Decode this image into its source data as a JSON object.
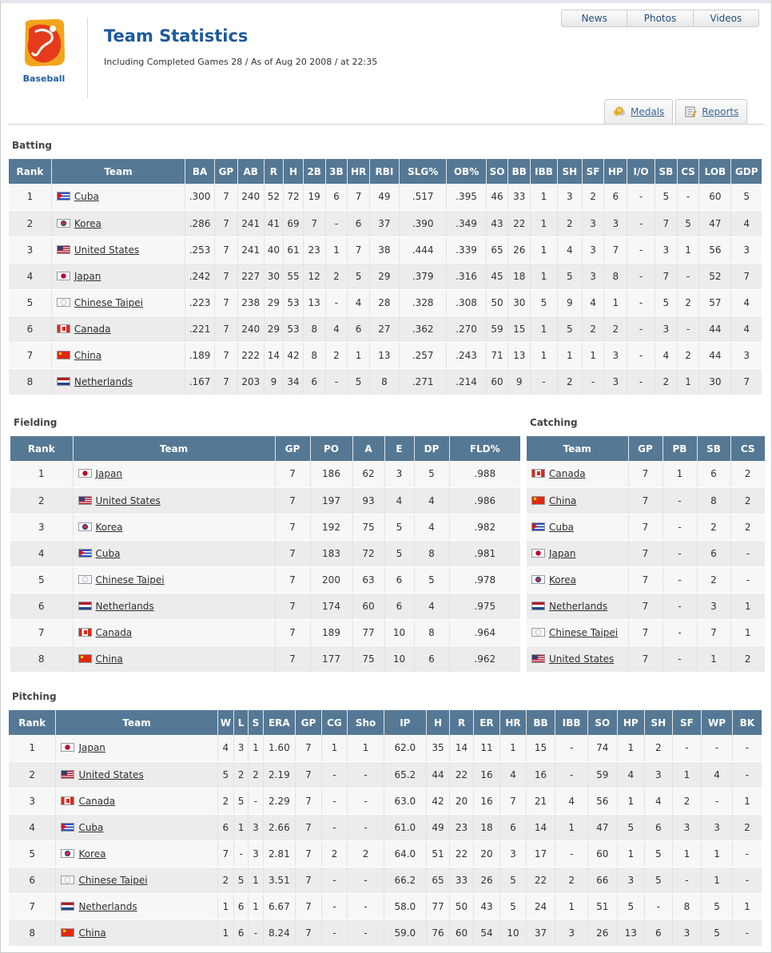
{
  "header": {
    "sport_label": "Baseball",
    "title": "Team Statistics",
    "subtitle": "Including Completed Games 28 / As of Aug 20 2008 / at 22:35"
  },
  "nav": {
    "news": "News",
    "photos": "Photos",
    "videos": "Videos"
  },
  "tabs": {
    "medals": "Medals",
    "reports": "Reports"
  },
  "batting": {
    "section_title": "Batting",
    "columns": [
      "Rank",
      "Team",
      "BA",
      "GP",
      "AB",
      "R",
      "H",
      "2B",
      "3B",
      "HR",
      "RBI",
      "SLG%",
      "OB%",
      "SO",
      "BB",
      "IBB",
      "SH",
      "SF",
      "HP",
      "I/O",
      "SB",
      "CS",
      "LOB",
      "GDP"
    ],
    "rows": [
      {
        "flag": "cuba",
        "cells": [
          "1",
          "Cuba",
          ".300",
          "7",
          "240",
          "52",
          "72",
          "19",
          "6",
          "7",
          "49",
          ".517",
          ".395",
          "46",
          "33",
          "1",
          "3",
          "2",
          "6",
          "-",
          "5",
          "-",
          "60",
          "5"
        ]
      },
      {
        "flag": "korea",
        "cells": [
          "2",
          "Korea",
          ".286",
          "7",
          "241",
          "41",
          "69",
          "7",
          "-",
          "6",
          "37",
          ".390",
          ".349",
          "43",
          "22",
          "1",
          "2",
          "3",
          "3",
          "-",
          "7",
          "5",
          "47",
          "4"
        ]
      },
      {
        "flag": "usa",
        "cells": [
          "3",
          "United States",
          ".253",
          "7",
          "241",
          "40",
          "61",
          "23",
          "1",
          "7",
          "38",
          ".444",
          ".339",
          "65",
          "26",
          "1",
          "4",
          "3",
          "7",
          "-",
          "3",
          "1",
          "56",
          "3"
        ]
      },
      {
        "flag": "japan",
        "cells": [
          "4",
          "Japan",
          ".242",
          "7",
          "227",
          "30",
          "55",
          "12",
          "2",
          "5",
          "29",
          ".379",
          ".316",
          "45",
          "18",
          "1",
          "5",
          "3",
          "8",
          "-",
          "7",
          "-",
          "52",
          "7"
        ]
      },
      {
        "flag": "tpe",
        "cells": [
          "5",
          "Chinese Taipei",
          ".223",
          "7",
          "238",
          "29",
          "53",
          "13",
          "-",
          "4",
          "28",
          ".328",
          ".308",
          "50",
          "30",
          "5",
          "9",
          "4",
          "1",
          "-",
          "5",
          "2",
          "57",
          "4"
        ]
      },
      {
        "flag": "canada",
        "cells": [
          "6",
          "Canada",
          ".221",
          "7",
          "240",
          "29",
          "53",
          "8",
          "4",
          "6",
          "27",
          ".362",
          ".270",
          "59",
          "15",
          "1",
          "5",
          "2",
          "2",
          "-",
          "3",
          "-",
          "44",
          "4"
        ]
      },
      {
        "flag": "china",
        "cells": [
          "7",
          "China",
          ".189",
          "7",
          "222",
          "14",
          "42",
          "8",
          "2",
          "1",
          "13",
          ".257",
          ".243",
          "71",
          "13",
          "1",
          "1",
          "1",
          "3",
          "-",
          "4",
          "2",
          "44",
          "3"
        ]
      },
      {
        "flag": "neth",
        "cells": [
          "8",
          "Netherlands",
          ".167",
          "7",
          "203",
          "9",
          "34",
          "6",
          "-",
          "5",
          "8",
          ".271",
          ".214",
          "60",
          "9",
          "-",
          "2",
          "-",
          "3",
          "-",
          "2",
          "1",
          "30",
          "7"
        ]
      }
    ]
  },
  "fielding": {
    "section_title": "Fielding",
    "columns": [
      "Rank",
      "Team",
      "GP",
      "PO",
      "A",
      "E",
      "DP",
      "FLD%"
    ],
    "rows": [
      {
        "flag": "japan",
        "cells": [
          "1",
          "Japan",
          "7",
          "186",
          "62",
          "3",
          "5",
          ".988"
        ]
      },
      {
        "flag": "usa",
        "cells": [
          "2",
          "United States",
          "7",
          "197",
          "93",
          "4",
          "4",
          ".986"
        ]
      },
      {
        "flag": "korea",
        "cells": [
          "3",
          "Korea",
          "7",
          "192",
          "75",
          "5",
          "4",
          ".982"
        ]
      },
      {
        "flag": "cuba",
        "cells": [
          "4",
          "Cuba",
          "7",
          "183",
          "72",
          "5",
          "8",
          ".981"
        ]
      },
      {
        "flag": "tpe",
        "cells": [
          "5",
          "Chinese Taipei",
          "7",
          "200",
          "63",
          "6",
          "5",
          ".978"
        ]
      },
      {
        "flag": "neth",
        "cells": [
          "6",
          "Netherlands",
          "7",
          "174",
          "60",
          "6",
          "4",
          ".975"
        ]
      },
      {
        "flag": "canada",
        "cells": [
          "7",
          "Canada",
          "7",
          "189",
          "77",
          "10",
          "8",
          ".964"
        ]
      },
      {
        "flag": "china",
        "cells": [
          "8",
          "China",
          "7",
          "177",
          "75",
          "10",
          "6",
          ".962"
        ]
      }
    ]
  },
  "catching": {
    "section_title": "Catching",
    "columns": [
      "Team",
      "GP",
      "PB",
      "SB",
      "CS"
    ],
    "rows": [
      {
        "flag": "canada",
        "cells": [
          "Canada",
          "7",
          "1",
          "6",
          "2"
        ]
      },
      {
        "flag": "china",
        "cells": [
          "China",
          "7",
          "-",
          "8",
          "2"
        ]
      },
      {
        "flag": "cuba",
        "cells": [
          "Cuba",
          "7",
          "-",
          "2",
          "2"
        ]
      },
      {
        "flag": "japan",
        "cells": [
          "Japan",
          "7",
          "-",
          "6",
          "-"
        ]
      },
      {
        "flag": "korea",
        "cells": [
          "Korea",
          "7",
          "-",
          "2",
          "-"
        ]
      },
      {
        "flag": "neth",
        "cells": [
          "Netherlands",
          "7",
          "-",
          "3",
          "1"
        ]
      },
      {
        "flag": "tpe",
        "cells": [
          "Chinese Taipei",
          "7",
          "-",
          "7",
          "1"
        ]
      },
      {
        "flag": "usa",
        "cells": [
          "United States",
          "7",
          "-",
          "1",
          "2"
        ]
      }
    ]
  },
  "pitching": {
    "section_title": "Pitching",
    "columns": [
      "Rank",
      "Team",
      "W",
      "L",
      "S",
      "ERA",
      "GP",
      "CG",
      "Sho",
      "IP",
      "H",
      "R",
      "ER",
      "HR",
      "BB",
      "IBB",
      "SO",
      "HP",
      "SH",
      "SF",
      "WP",
      "BK"
    ],
    "rows": [
      {
        "flag": "japan",
        "cells": [
          "1",
          "Japan",
          "4",
          "3",
          "1",
          "1.60",
          "7",
          "1",
          "1",
          "62.0",
          "35",
          "14",
          "11",
          "1",
          "15",
          "-",
          "74",
          "1",
          "2",
          "-",
          "-",
          "-"
        ]
      },
      {
        "flag": "usa",
        "cells": [
          "2",
          "United States",
          "5",
          "2",
          "2",
          "2.19",
          "7",
          "-",
          "-",
          "65.2",
          "44",
          "22",
          "16",
          "4",
          "16",
          "-",
          "59",
          "4",
          "3",
          "1",
          "4",
          "-"
        ]
      },
      {
        "flag": "canada",
        "cells": [
          "3",
          "Canada",
          "2",
          "5",
          "-",
          "2.29",
          "7",
          "-",
          "-",
          "63.0",
          "42",
          "20",
          "16",
          "7",
          "21",
          "4",
          "56",
          "1",
          "4",
          "2",
          "-",
          "1"
        ]
      },
      {
        "flag": "cuba",
        "cells": [
          "4",
          "Cuba",
          "6",
          "1",
          "3",
          "2.66",
          "7",
          "-",
          "-",
          "61.0",
          "49",
          "23",
          "18",
          "6",
          "14",
          "1",
          "47",
          "5",
          "6",
          "3",
          "3",
          "2"
        ]
      },
      {
        "flag": "korea",
        "cells": [
          "5",
          "Korea",
          "7",
          "-",
          "3",
          "2.81",
          "7",
          "2",
          "2",
          "64.0",
          "51",
          "22",
          "20",
          "3",
          "17",
          "-",
          "60",
          "1",
          "5",
          "1",
          "1",
          "-"
        ]
      },
      {
        "flag": "tpe",
        "cells": [
          "6",
          "Chinese Taipei",
          "2",
          "5",
          "1",
          "3.51",
          "7",
          "-",
          "-",
          "66.2",
          "65",
          "33",
          "26",
          "5",
          "22",
          "2",
          "66",
          "3",
          "5",
          "-",
          "1",
          "-"
        ]
      },
      {
        "flag": "neth",
        "cells": [
          "7",
          "Netherlands",
          "1",
          "6",
          "1",
          "6.67",
          "7",
          "-",
          "-",
          "58.0",
          "77",
          "50",
          "43",
          "5",
          "24",
          "1",
          "51",
          "5",
          "-",
          "8",
          "5",
          "1"
        ]
      },
      {
        "flag": "china",
        "cells": [
          "8",
          "China",
          "1",
          "6",
          "-",
          "8.24",
          "7",
          "-",
          "-",
          "59.0",
          "76",
          "60",
          "54",
          "10",
          "37",
          "3",
          "26",
          "13",
          "6",
          "3",
          "5",
          "-"
        ]
      }
    ]
  }
}
